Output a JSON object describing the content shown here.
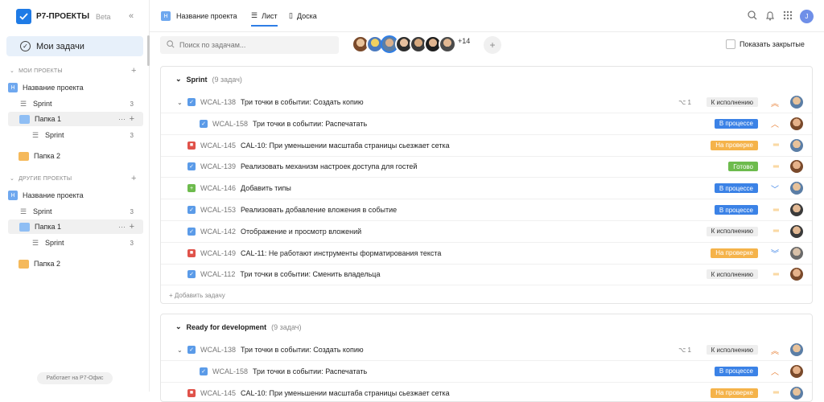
{
  "sidebar": {
    "logo": "Р7-ПРОЕКТЫ",
    "beta": "Beta",
    "collapse": "«",
    "my_tasks": "Мои задачи",
    "my_projects_section": "МОИ ПРОЕКТЫ",
    "other_projects_section": "ДРУГИЕ ПРОЕКТЫ",
    "my_projects": [
      {
        "type": "project",
        "label": "Название проекта",
        "badge": "Н"
      },
      {
        "type": "list",
        "label": "Sprint",
        "count": "3"
      },
      {
        "type": "folder",
        "label": "Папка 1",
        "color": "blue",
        "highlight": true
      },
      {
        "type": "sublist",
        "label": "Sprint",
        "count": "3"
      },
      {
        "type": "folder",
        "label": "Папка 2",
        "color": "orange"
      }
    ],
    "other_projects": [
      {
        "type": "project",
        "label": "Название проекта",
        "badge": "Н"
      },
      {
        "type": "list",
        "label": "Sprint",
        "count": "3"
      },
      {
        "type": "folder",
        "label": "Папка 1",
        "color": "blue",
        "highlight": true
      },
      {
        "type": "sublist",
        "label": "Sprint",
        "count": "3"
      },
      {
        "type": "folder",
        "label": "Папка 2",
        "color": "orange"
      }
    ],
    "footer": "Работает на Р7-Офис"
  },
  "topbar": {
    "project_badge": "Н",
    "project_name": "Название проекта",
    "tab_list": "Лист",
    "tab_board": "Доска",
    "user_initial": "J"
  },
  "toolbar": {
    "search_placeholder": "Поиск по задачам...",
    "more_members": "+14",
    "show_closed": "Показать закрытые"
  },
  "colors": {
    "accent": "#2f7ee6",
    "status_in_progress": "#3b82e6",
    "status_review": "#f5b34a",
    "status_done": "#6dbb4d",
    "status_todo": "#eeeeee"
  },
  "groups": [
    {
      "name": "Sprint",
      "count": "(9 задач)",
      "add_task": "+ Добавить задачу",
      "tasks": [
        {
          "key": "WCAL-138",
          "title": "Три точки в событии: Создать копию",
          "type": "task",
          "expand": true,
          "subtasks": "1",
          "status": "К исполнению",
          "status_kind": "todo",
          "priority": "high",
          "avatar": "a1"
        },
        {
          "key": "WCAL-158",
          "title": "Три точки в событии: Распечатать",
          "type": "task",
          "sub": true,
          "status": "В процессе",
          "status_kind": "progress",
          "priority": "medium-up",
          "avatar": "a2"
        },
        {
          "key": "WCAL-145",
          "title": "CAL-10: При уменьшении масштаба страницы сьезжает сетка",
          "type": "bug",
          "status": "На проверке",
          "status_kind": "review",
          "priority": "normal",
          "avatar": "a1"
        },
        {
          "key": "WCAL-139",
          "title": "Реализовать механизм настроек доступа для гостей",
          "type": "task",
          "status": "Готово",
          "status_kind": "done",
          "priority": "normal",
          "avatar": "a2"
        },
        {
          "key": "WCAL-146",
          "title": "Добавить типы",
          "type": "feature",
          "status": "В процессе",
          "status_kind": "progress",
          "priority": "low",
          "avatar": "a1"
        },
        {
          "key": "WCAL-153",
          "title": "Реализовать добавление вложения в событие",
          "type": "task",
          "status": "В процессе",
          "status_kind": "progress",
          "priority": "normal",
          "avatar": "a3"
        },
        {
          "key": "WCAL-142",
          "title": "Отображение и просмотр вложений",
          "type": "task",
          "status": "К исполнению",
          "status_kind": "todo",
          "priority": "normal",
          "avatar": "a3"
        },
        {
          "key": "WCAL-149",
          "title": "CAL-11: Не работают инструменты форматирования текста",
          "type": "bug",
          "status": "На проверке",
          "status_kind": "review",
          "priority": "lowest",
          "avatar": "a4"
        },
        {
          "key": "WCAL-112",
          "title": "Три точки в событии: Сменить владельца",
          "type": "task",
          "status": "К исполнению",
          "status_kind": "todo",
          "priority": "normal",
          "avatar": "a2"
        }
      ]
    },
    {
      "name": "Ready for development",
      "count": "(9 задач)",
      "tasks": [
        {
          "key": "WCAL-138",
          "title": "Три точки в событии: Создать копию",
          "type": "task",
          "expand": true,
          "subtasks": "1",
          "status": "К исполнению",
          "status_kind": "todo",
          "priority": "high",
          "avatar": "a1"
        },
        {
          "key": "WCAL-158",
          "title": "Три точки в событии: Распечатать",
          "type": "task",
          "sub": true,
          "status": "В процессе",
          "status_kind": "progress",
          "priority": "medium-up",
          "avatar": "a2"
        },
        {
          "key": "WCAL-145",
          "title": "CAL-10: При уменьшении масштаба страницы сьезжает сетка",
          "type": "bug",
          "status": "На проверке",
          "status_kind": "review",
          "priority": "normal",
          "avatar": "a1"
        }
      ]
    }
  ]
}
